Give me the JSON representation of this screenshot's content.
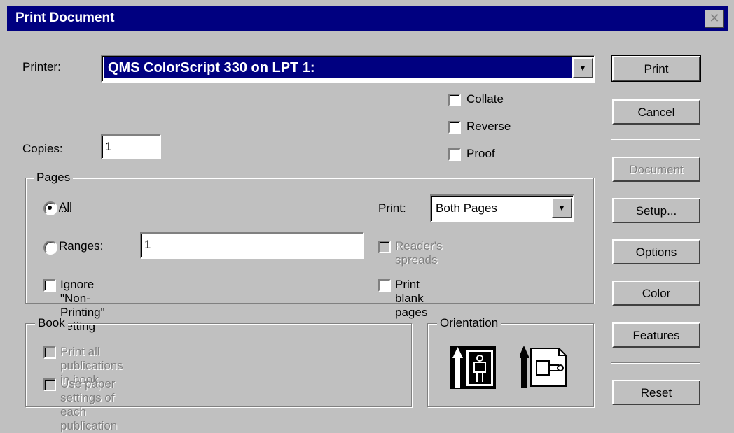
{
  "dialog": {
    "title": "Print Document",
    "close_symbol": "✕"
  },
  "printer": {
    "label": "Printer:",
    "value": "QMS ColorScript 330 on LPT 1:"
  },
  "options": {
    "collate": "Collate",
    "reverse": "Reverse",
    "proof": "Proof"
  },
  "copies": {
    "label": "Copies:",
    "value": "1"
  },
  "pages": {
    "group_title": "Pages",
    "all_label": "All",
    "ranges_label": "Ranges:",
    "ranges_value": "1",
    "ignore_label": "Ignore \"Non-Printing\" setting",
    "print_label": "Print:",
    "print_value": "Both Pages",
    "readers_spreads_label": "Reader's spreads",
    "print_blank_label": "Print blank pages"
  },
  "book": {
    "group_title": "Book",
    "print_all_label": "Print all publications in book",
    "use_paper_label": "Use paper settings of each publication"
  },
  "orientation": {
    "group_title": "Orientation",
    "options": [
      "portrait",
      "landscape"
    ]
  },
  "buttons": {
    "print": "Print",
    "cancel": "Cancel",
    "document": "Document",
    "setup": "Setup...",
    "options": "Options",
    "color": "Color",
    "features": "Features",
    "reset": "Reset"
  }
}
